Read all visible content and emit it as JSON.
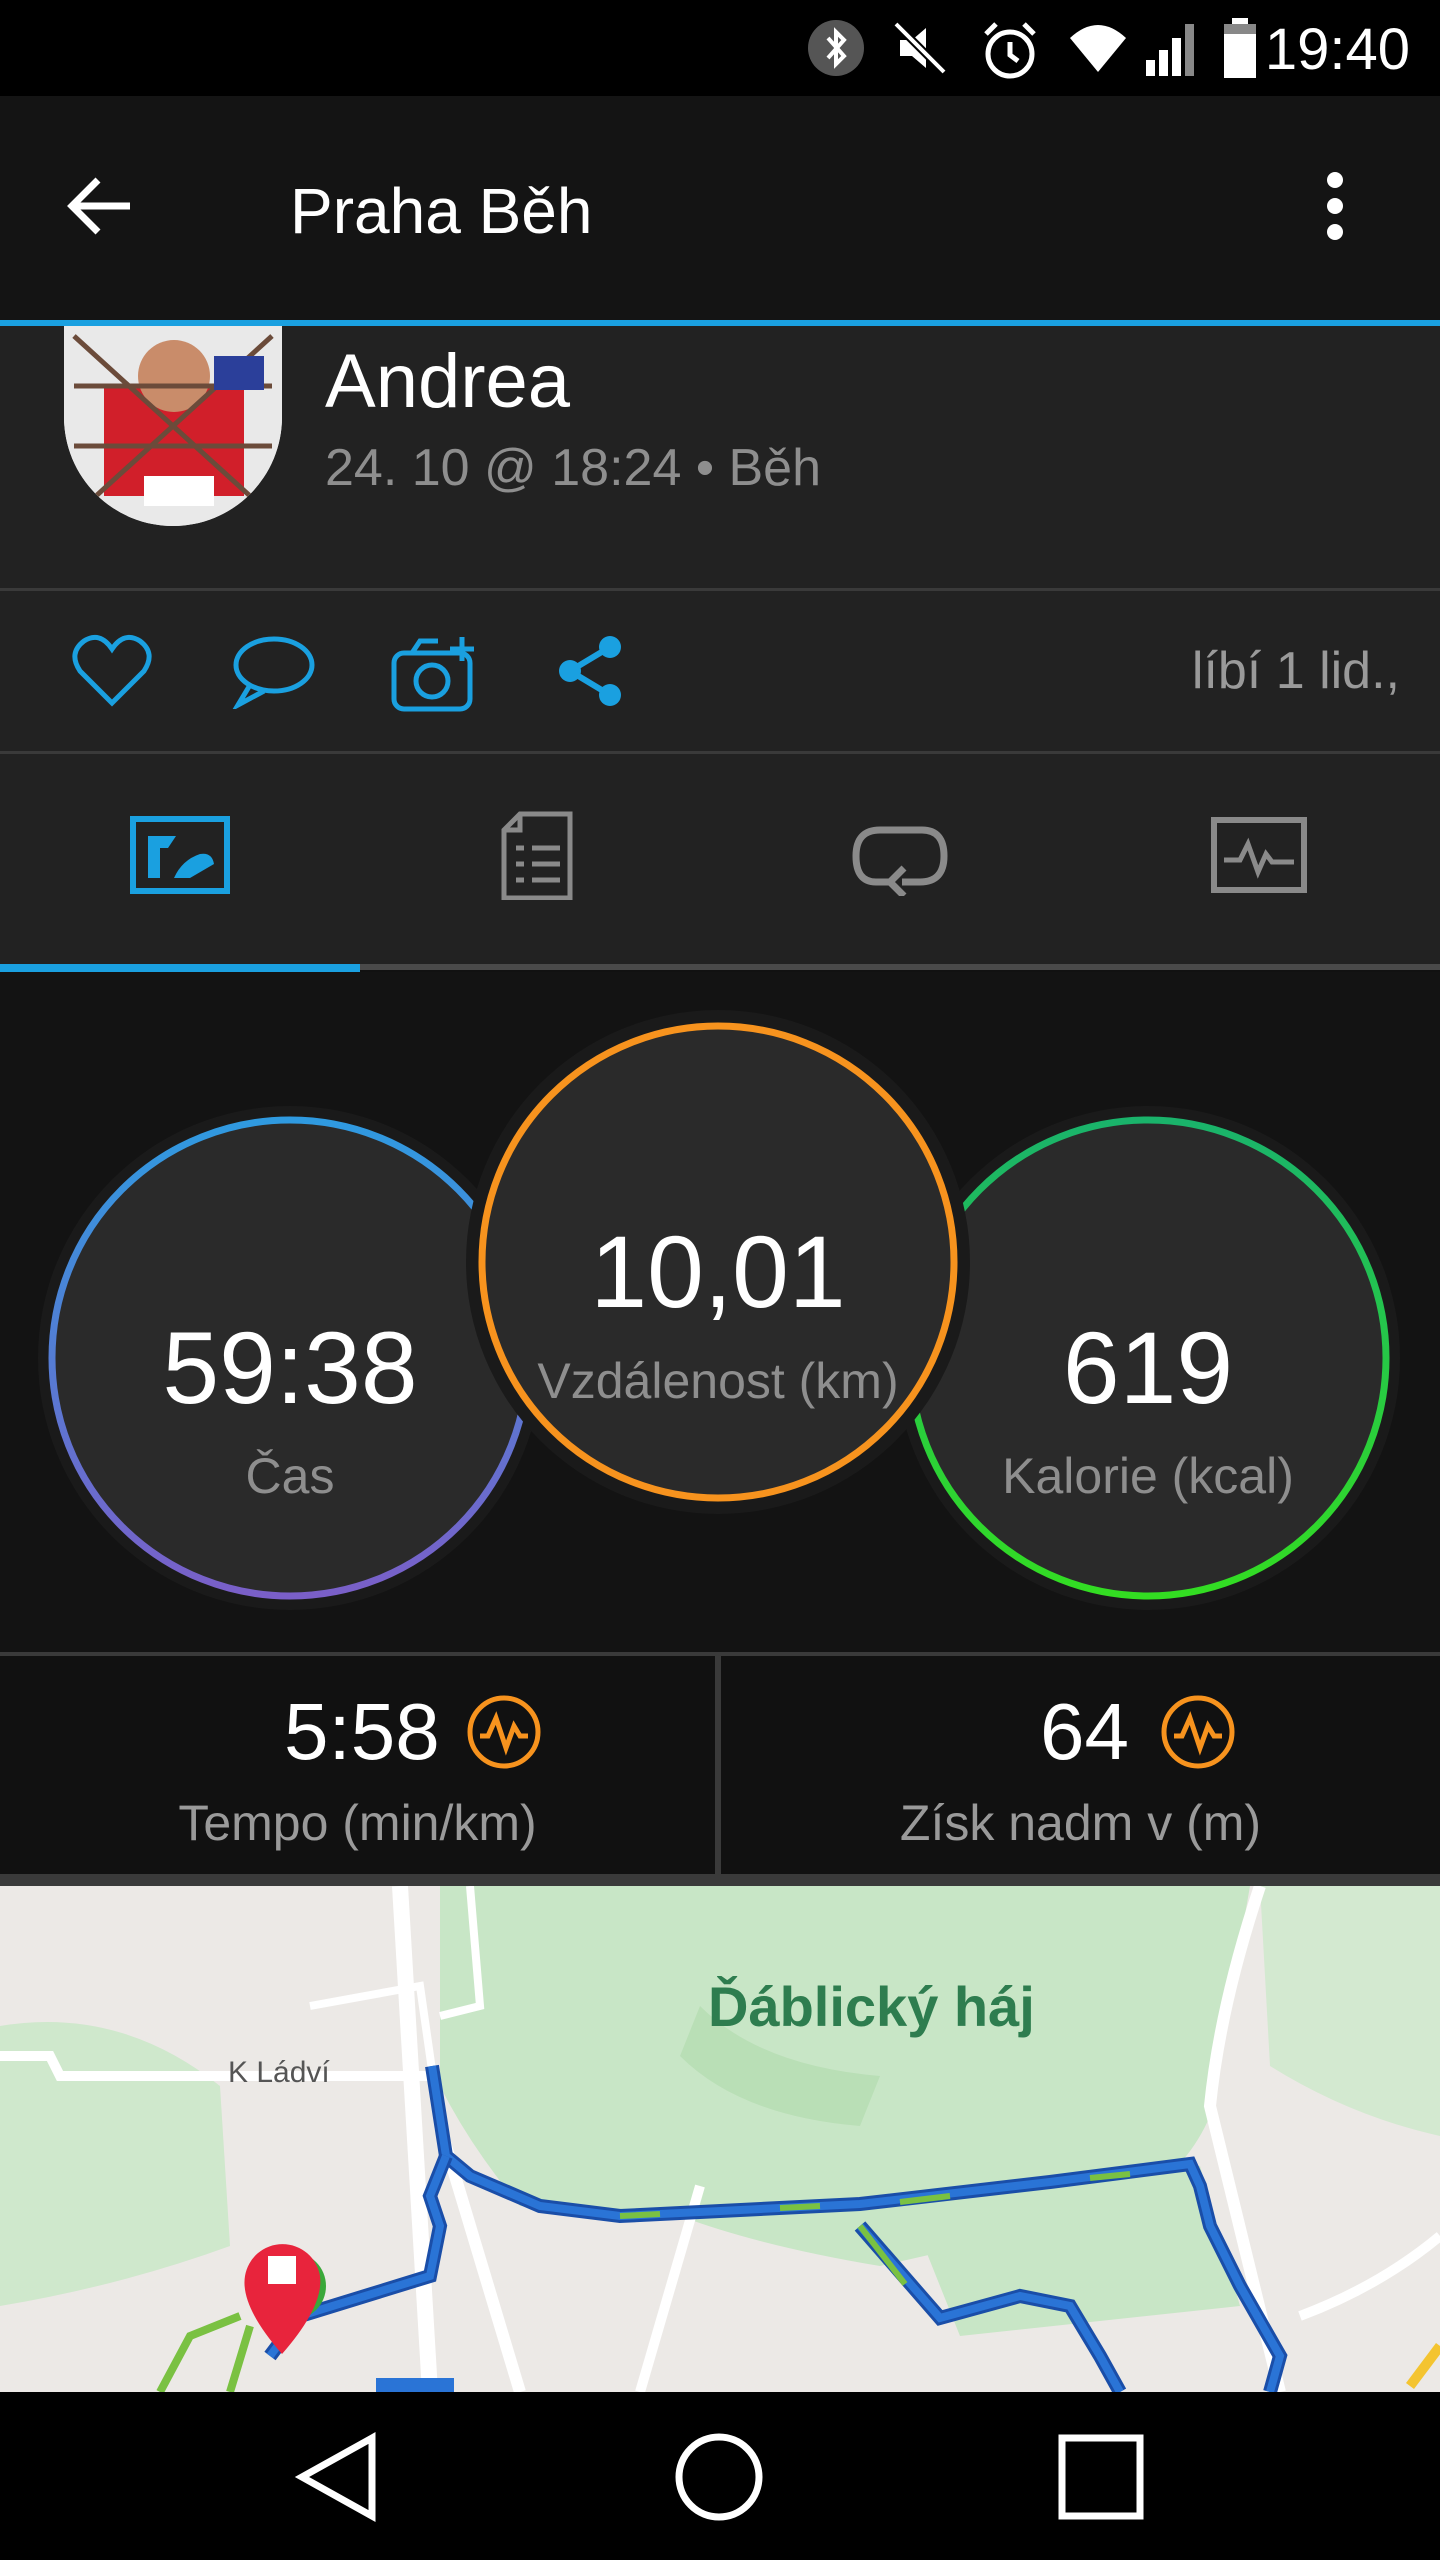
{
  "status_bar": {
    "time": "19:40",
    "icons": [
      "bluetooth-icon",
      "mute-icon",
      "alarm-icon",
      "wifi-icon",
      "signal-icon",
      "battery-icon"
    ]
  },
  "app_bar": {
    "title": "Praha Běh",
    "back_icon": "arrow-left-icon",
    "menu_icon": "more-vert-icon",
    "accent": "#1aa0e0"
  },
  "profile": {
    "name": "Andrea",
    "meta": "24. 10 @ 18:24 • Běh"
  },
  "actions": {
    "items": [
      "heart-icon",
      "comment-icon",
      "add-photo-icon",
      "share-icon"
    ],
    "likes_text": "líbí 1 lid.,"
  },
  "tabs": {
    "items": [
      "summary-tab-icon",
      "details-tab-icon",
      "laps-tab-icon",
      "charts-tab-icon"
    ],
    "active_index": 0
  },
  "summary": {
    "time": {
      "value": "59:38",
      "label": "Čas",
      "ring_colors": [
        "#2f9ae0",
        "#7a5fc8"
      ]
    },
    "distance": {
      "value": "10,01",
      "label": "Vzdálenost (km)",
      "ring_color": "#f7931e"
    },
    "calories": {
      "value": "619",
      "label": "Kalorie (kcal)",
      "ring_colors": [
        "#1ab36b",
        "#33dd22"
      ]
    }
  },
  "stats": [
    {
      "value": "5:58",
      "label": "Tempo (min/km)",
      "icon": "pace-chart-icon",
      "icon_color": "#f7931e"
    },
    {
      "value": "64",
      "label": "Získ nadm v (m)",
      "icon": "elevation-chart-icon",
      "icon_color": "#f7931e"
    }
  ],
  "map": {
    "park_label": "Ďáblický háj",
    "street_label": "K Ládví",
    "route_color": "#2a74d6",
    "route_segment_color": "#7ac142"
  },
  "nav_bar": {
    "items": [
      "back-triangle-icon",
      "home-circle-icon",
      "recents-square-icon"
    ]
  }
}
